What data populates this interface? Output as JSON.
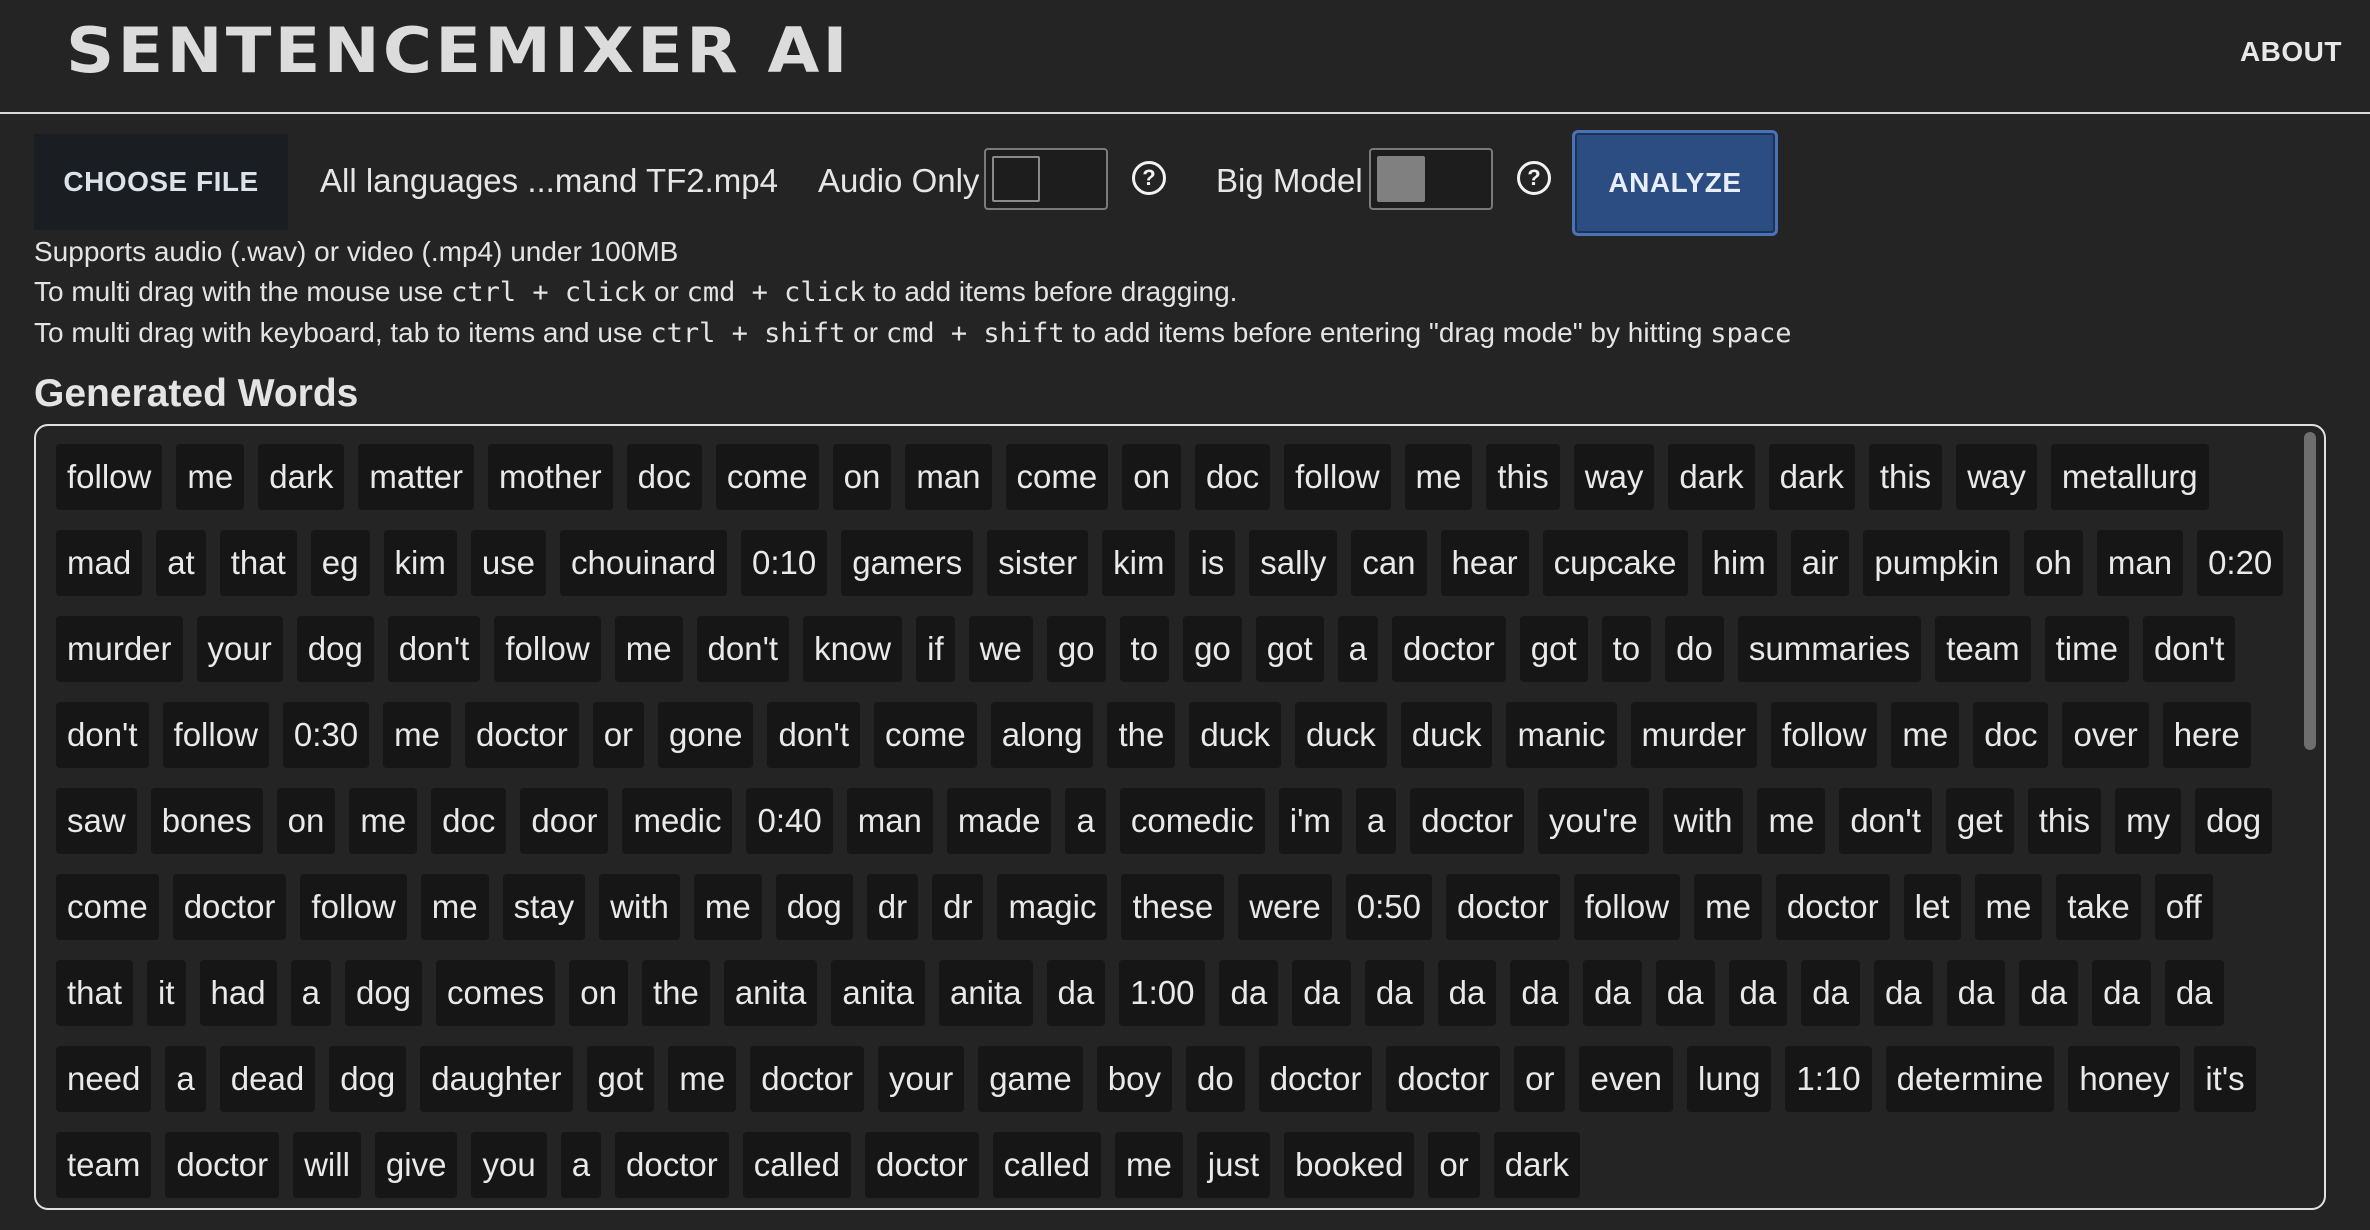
{
  "header": {
    "title": "SENTENCEMIXER AI",
    "about": "ABOUT"
  },
  "controls": {
    "choose_file": "CHOOSE FILE",
    "filename": "All languages ...mand TF2.mp4",
    "audio_only_label": "Audio Only",
    "audio_only_on": false,
    "big_model_label": "Big Model",
    "big_model_on": true,
    "help": "?",
    "analyze": "ANALYZE"
  },
  "info": {
    "line1": "Supports audio (.wav) or video (.mp4) under 100MB",
    "l2a": "To multi drag with the mouse use ",
    "l2code1": "ctrl + click",
    "l2b": " or ",
    "l2code2": "cmd + click",
    "l2c": " to add items before dragging.",
    "l3a": "To multi drag with keyboard, tab to items and use ",
    "l3code1": "ctrl + shift",
    "l3b": " or ",
    "l3code2": "cmd + shift",
    "l3c": " to add items before entering \"drag mode\" by hitting ",
    "l3code3": "space"
  },
  "generated": {
    "title": "Generated Words",
    "words": [
      "follow",
      "me",
      "dark",
      "matter",
      "mother",
      "doc",
      "come",
      "on",
      "man",
      "come",
      "on",
      "doc",
      "follow",
      "me",
      "this",
      "way",
      "dark",
      "dark",
      "this",
      "way",
      "metallurg",
      "mad",
      "at",
      "that",
      "eg",
      "kim",
      "use",
      "chouinard",
      "0:10",
      "gamers",
      "sister",
      "kim",
      "is",
      "sally",
      "can",
      "hear",
      "cupcake",
      "him",
      "air",
      "pumpkin",
      "oh",
      "man",
      "0:20",
      "murder",
      "your",
      "dog",
      "don't",
      "follow",
      "me",
      "don't",
      "know",
      "if",
      "we",
      "go",
      "to",
      "go",
      "got",
      "a",
      "doctor",
      "got",
      "to",
      "do",
      "summaries",
      "team",
      "time",
      "don't",
      "don't",
      "follow",
      "0:30",
      "me",
      "doctor",
      "or",
      "gone",
      "don't",
      "come",
      "along",
      "the",
      "duck",
      "duck",
      "duck",
      "manic",
      "murder",
      "follow",
      "me",
      "doc",
      "over",
      "here",
      "saw",
      "bones",
      "on",
      "me",
      "doc",
      "door",
      "medic",
      "0:40",
      "man",
      "made",
      "a",
      "comedic",
      "i'm",
      "a",
      "doctor",
      "you're",
      "with",
      "me",
      "don't",
      "get",
      "this",
      "my",
      "dog",
      "come",
      "doctor",
      "follow",
      "me",
      "stay",
      "with",
      "me",
      "dog",
      "dr",
      "dr",
      "magic",
      "these",
      "were",
      "0:50",
      "doctor",
      "follow",
      "me",
      "doctor",
      "let",
      "me",
      "take",
      "off",
      "that",
      "it",
      "had",
      "a",
      "dog",
      "comes",
      "on",
      "the",
      "anita",
      "anita",
      "anita",
      "da",
      "1:00",
      "da",
      "da",
      "da",
      "da",
      "da",
      "da",
      "da",
      "da",
      "da",
      "da",
      "da",
      "da",
      "da",
      "da",
      "need",
      "a",
      "dead",
      "dog",
      "daughter",
      "got",
      "me",
      "doctor",
      "your",
      "game",
      "boy",
      "do",
      "doctor",
      "doctor",
      "or",
      "even",
      "lung",
      "1:10",
      "determine",
      "honey",
      "it's",
      "team",
      "doctor",
      "will",
      "give",
      "you",
      "a",
      "doctor",
      "called",
      "doctor",
      "called",
      "me",
      "just",
      "booked",
      "or",
      "dark"
    ]
  }
}
